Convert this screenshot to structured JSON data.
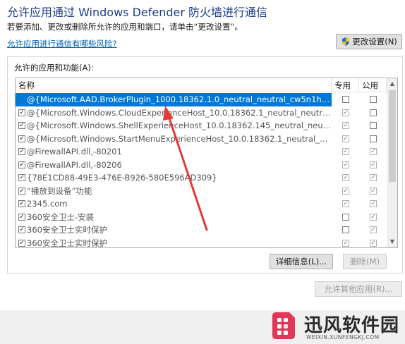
{
  "window": {
    "title": "允许应用通过 Windows Defender 防火墙进行通信",
    "subtitle": "若要添加、更改或删除所允许的应用和端口，请单击“更改设置”。",
    "risk_link": "允许应用进行通信有哪些风险?",
    "change_settings_button": "更改设置(N)"
  },
  "group": {
    "label": "允许的应用和功能(A):",
    "columns": {
      "name": "名称",
      "private": "专用",
      "public": "公用"
    },
    "rows": [
      {
        "enabled": true,
        "name": "@{Microsoft.AAD.BrokerPlugin_1000.18362.1.0_neutral_neutral_cw5n1h2tx...",
        "private": false,
        "public": false,
        "selected": true
      },
      {
        "enabled": true,
        "name": "@{Microsoft.Windows.CloudExperienceHost_10.0.18362.1_neutral_neutral_...",
        "private": true,
        "public": false,
        "selected": false
      },
      {
        "enabled": true,
        "name": "@{Microsoft.Windows.ShellExperienceHost_10.0.18362.145_neutral_neutra...",
        "private": true,
        "public": false,
        "selected": false
      },
      {
        "enabled": true,
        "name": "@{Microsoft.Windows.StartMenuExperienceHost_10.0.18362.1_neutral_ne...",
        "private": true,
        "public": false,
        "selected": false
      },
      {
        "enabled": true,
        "name": "@FirewallAPI.dll,-80201",
        "private": true,
        "public": true,
        "selected": false
      },
      {
        "enabled": true,
        "name": "@FirewallAPI.dll,-80206",
        "private": true,
        "public": true,
        "selected": false
      },
      {
        "enabled": true,
        "name": "{78E1CD88-49E3-476E-B926-580E596AD309}",
        "private": true,
        "public": true,
        "selected": false
      },
      {
        "enabled": true,
        "name": "“播放到设备”功能",
        "private": true,
        "public": true,
        "selected": false
      },
      {
        "enabled": true,
        "name": "2345.com",
        "private": true,
        "public": true,
        "selected": false
      },
      {
        "enabled": true,
        "name": "360安全卫士-安装",
        "private": false,
        "public": true,
        "selected": false
      },
      {
        "enabled": true,
        "name": "360安全卫士实时保护",
        "private": false,
        "public": true,
        "selected": false
      },
      {
        "enabled": true,
        "name": "360安全卫士实时保护",
        "private": true,
        "public": true,
        "selected": false
      }
    ],
    "details_button": "详细信息(L)...",
    "delete_button": "删除(M)"
  },
  "allow_other_button": "允许其他应用(R)...",
  "watermark": {
    "name": "迅风软件园",
    "url": "WEIXIN.XUNFENGKJ.COM"
  },
  "colors": {
    "title": "#1b3e8a",
    "link": "#0063b1",
    "selection": "#0078d7",
    "arrow": "#e53935",
    "watermark_logo": "#e2365a"
  },
  "icons": {
    "uac": "shield-icon",
    "scroll_up": "chevron-up-icon",
    "scroll_down": "chevron-down-icon"
  }
}
